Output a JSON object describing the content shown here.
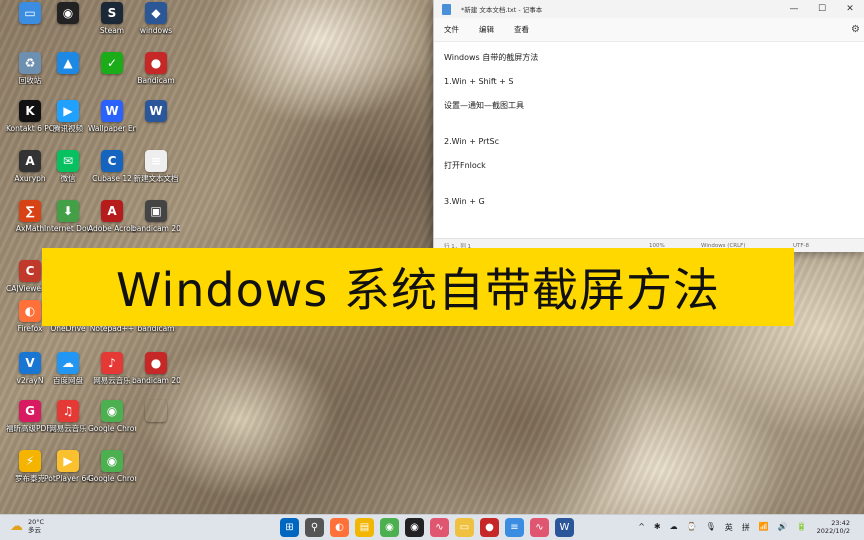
{
  "desktop": {
    "icons": [
      {
        "label": "",
        "glyph": "▭",
        "color": "#3a8de0"
      },
      {
        "label": "",
        "glyph": "◉",
        "color": "#222222"
      },
      {
        "label": "Steam",
        "glyph": "S",
        "color": "#1b2838"
      },
      {
        "label": "windows",
        "glyph": "◆",
        "color": "#2b5797"
      },
      {
        "label": "回收站",
        "glyph": "♻",
        "color": "#6d8fb0"
      },
      {
        "label": "",
        "glyph": "▲",
        "color": "#1e88e5"
      },
      {
        "label": "",
        "glyph": "✓",
        "color": "#1aad19"
      },
      {
        "label": "Bandicam",
        "glyph": "●",
        "color": "#c62828"
      },
      {
        "label": "Kontakt 6 PORTABLE",
        "glyph": "K",
        "color": "#111111"
      },
      {
        "label": "腾讯视频",
        "glyph": "▶",
        "color": "#20a0ff"
      },
      {
        "label": "Wallpaper Engine",
        "glyph": "W",
        "color": "#2962ff"
      },
      {
        "label": "",
        "glyph": "W",
        "color": "#2b579a"
      },
      {
        "label": "Axuryph",
        "glyph": "A",
        "color": "#333333"
      },
      {
        "label": "微信",
        "glyph": "✉",
        "color": "#07c160"
      },
      {
        "label": "Cubase 12",
        "glyph": "C",
        "color": "#1565c0"
      },
      {
        "label": "新建文本文档",
        "glyph": "≡",
        "color": "#eeeeee"
      },
      {
        "label": "AxMath",
        "glyph": "∑",
        "color": "#d84315"
      },
      {
        "label": "Internet Download",
        "glyph": "⬇",
        "color": "#43a047"
      },
      {
        "label": "Adobe Acrobat DC",
        "glyph": "A",
        "color": "#b71c1c"
      },
      {
        "label": "bandicam 2022-10...",
        "glyph": "▣",
        "color": "#444444"
      },
      {
        "label": "CAJViewer 7.3",
        "glyph": "C",
        "color": "#c0392b"
      },
      {
        "label": "",
        "glyph": "◎",
        "color": "#5e35b1"
      },
      {
        "label": "",
        "glyph": "▦",
        "color": "#37474f"
      },
      {
        "label": "",
        "glyph": "▣",
        "color": "#555555"
      },
      {
        "label": "Firefox",
        "glyph": "◐",
        "color": "#ff7139"
      },
      {
        "label": "OneDrive",
        "glyph": "☁",
        "color": "#0078d4"
      },
      {
        "label": "Notepad++",
        "glyph": "N",
        "color": "#7cb342"
      },
      {
        "label": "bandicam",
        "glyph": "▣",
        "color": "#555555"
      },
      {
        "label": "v2rayN",
        "glyph": "V",
        "color": "#1976d2"
      },
      {
        "label": "百度网盘",
        "glyph": "☁",
        "color": "#2196f3"
      },
      {
        "label": "网易云音乐",
        "glyph": "♪",
        "color": "#e53935"
      },
      {
        "label": "bandicam 2022-10-0...",
        "glyph": "●",
        "color": "#c62828"
      },
      {
        "label": "福昕高级PDF编辑器",
        "glyph": "G",
        "color": "#d81b60"
      },
      {
        "label": "网易云音乐",
        "glyph": "♫",
        "color": "#e53935"
      },
      {
        "label": "Google Chrome",
        "glyph": "◉",
        "color": "#4caf50"
      },
      {
        "label": "",
        "glyph": "",
        "color": "rgba(0,0,0,0)"
      },
      {
        "label": "罗布泰克",
        "glyph": "⚡",
        "color": "#f4b400"
      },
      {
        "label": "PotPlayer 64 bit",
        "glyph": "▶",
        "color": "#fbc02d"
      },
      {
        "label": "Google Chrome",
        "glyph": "◉",
        "color": "#4caf50"
      }
    ]
  },
  "notepad": {
    "title": "*新建 文本文档.txt - 记事本",
    "controls": {
      "minimize": "—",
      "maximize": "☐",
      "close": "✕"
    },
    "menu": [
      "文件",
      "编辑",
      "查看"
    ],
    "settings_icon": "⚙",
    "lines": [
      "Windows 自带的截屏方法",
      "",
      "1.Win + Shift + S",
      "",
      "设置—通知—截图工具",
      "",
      "",
      "2.Win + PrtSc",
      "",
      "打开Fnlock",
      "",
      "",
      "3.Win + G"
    ],
    "status": {
      "position": "行 1，列 1",
      "zoom": "100%",
      "eol": "Windows (CRLF)",
      "encoding": "UTF-8"
    }
  },
  "banner": {
    "text": "Windows 系统自带截屏方法",
    "color": "#ffd800"
  },
  "taskbar": {
    "weather_temp": "20°C",
    "weather_desc": "多云",
    "apps": [
      {
        "name": "start",
        "glyph": "⊞",
        "color": "#0067c0"
      },
      {
        "name": "search",
        "glyph": "⚲",
        "color": "#555555"
      },
      {
        "name": "firefox",
        "glyph": "◐",
        "color": "#ff7139"
      },
      {
        "name": "file-explorer",
        "glyph": "▤",
        "color": "#f2b705"
      },
      {
        "name": "chrome",
        "glyph": "◉",
        "color": "#4caf50"
      },
      {
        "name": "qq",
        "glyph": "◉",
        "color": "#222222"
      },
      {
        "name": "audio-app",
        "glyph": "∿",
        "color": "#e0556f"
      },
      {
        "name": "explorer",
        "glyph": "▭",
        "color": "#f0c040"
      },
      {
        "name": "bandicam",
        "glyph": "●",
        "color": "#c62828"
      },
      {
        "name": "notepad",
        "glyph": "≡",
        "color": "#3a8de0"
      },
      {
        "name": "audio-app-2",
        "glyph": "∿",
        "color": "#e0556f"
      },
      {
        "name": "word",
        "glyph": "W",
        "color": "#2b579a"
      }
    ],
    "tray": [
      "^",
      "✱",
      "☁",
      "⌚",
      "🎙",
      "英",
      "拼",
      "📶",
      "🔊",
      "🔋"
    ],
    "time": "23:42",
    "date": "2022/10/2"
  }
}
